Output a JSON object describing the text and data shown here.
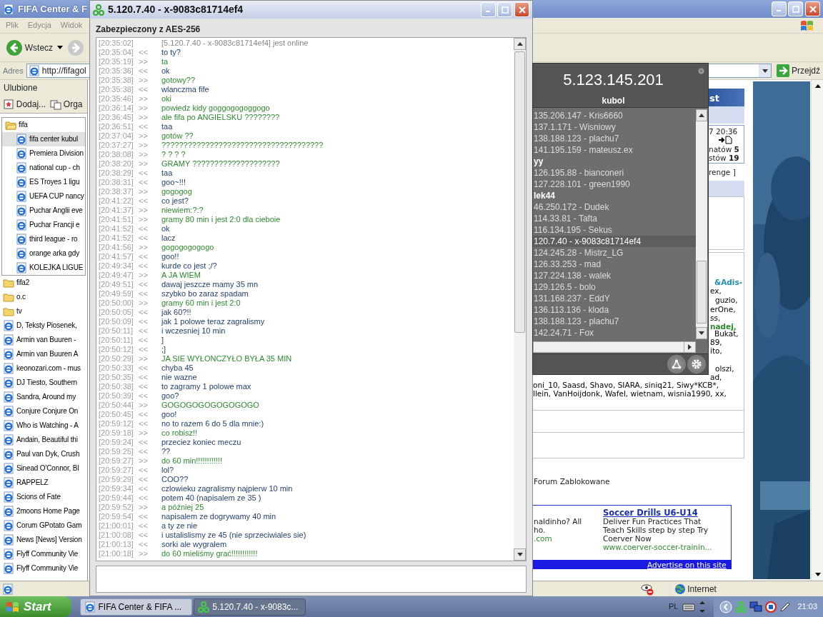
{
  "browser": {
    "title": "FIFA Center & F",
    "menu": [
      "Plik",
      "Edycja",
      "Widok"
    ],
    "back_button": "Wstecz",
    "address_label": "Adres",
    "address": "http://fifagol",
    "go_button": "Przejdź",
    "favorites": {
      "title": "Ulubione",
      "add_button": "Dodaj...",
      "organize_button": "Orga",
      "items": [
        {
          "label": "fifa",
          "kind": "folder",
          "selected": false,
          "expanded": true,
          "children": [
            {
              "label": "fifa center kubul",
              "kind": "page",
              "selected": true
            },
            {
              "label": "Premiera Division",
              "kind": "page",
              "selected": false
            },
            {
              "label": "national cup - ch",
              "kind": "page",
              "selected": false
            },
            {
              "label": "ES Troyes 1 ligu",
              "kind": "page",
              "selected": false
            },
            {
              "label": "UEFA CUP nancy",
              "kind": "page",
              "selected": false
            },
            {
              "label": "Puchar Anglii eve",
              "kind": "page",
              "selected": false
            },
            {
              "label": "Puchar Francji e",
              "kind": "page",
              "selected": false
            },
            {
              "label": "third league - ro",
              "kind": "page",
              "selected": false
            },
            {
              "label": "orange arka gdy",
              "kind": "page",
              "selected": false
            },
            {
              "label": "KOLEJKA LIGUE",
              "kind": "page",
              "selected": false
            }
          ]
        },
        {
          "label": "fifa2",
          "kind": "folder",
          "selected": false,
          "expanded": false
        },
        {
          "label": "o.c",
          "kind": "folder",
          "selected": false,
          "expanded": false
        },
        {
          "label": "tv",
          "kind": "folder",
          "selected": false,
          "expanded": false
        },
        {
          "label": "D, Teksty Piosenek,",
          "kind": "page",
          "selected": false
        },
        {
          "label": "Armin van Buuren -",
          "kind": "page",
          "selected": false
        },
        {
          "label": "Armin van Buuren  A",
          "kind": "page",
          "selected": false
        },
        {
          "label": "keonozari.com - mus",
          "kind": "page",
          "selected": false
        },
        {
          "label": "DJ Tiesto, Southern",
          "kind": "page",
          "selected": false
        },
        {
          "label": "Sandra, Around my",
          "kind": "page",
          "selected": false
        },
        {
          "label": "Conjure Conjure On",
          "kind": "page",
          "selected": false
        },
        {
          "label": "Who is Watching - A",
          "kind": "page",
          "selected": false
        },
        {
          "label": "Andain, Beautiful thi",
          "kind": "page",
          "selected": false
        },
        {
          "label": "Paul van Dyk, Crush",
          "kind": "page",
          "selected": false
        },
        {
          "label": "Sinead O'Connor, Bl",
          "kind": "page",
          "selected": false
        },
        {
          "label": "RAPPELZ",
          "kind": "page",
          "selected": false
        },
        {
          "label": "Scions of Fate",
          "kind": "page",
          "selected": false
        },
        {
          "label": "2moons Home Page",
          "kind": "page",
          "selected": false
        },
        {
          "label": "Corum GPotato Gam",
          "kind": "page",
          "selected": false
        },
        {
          "label": "News [News] Version",
          "kind": "page",
          "selected": false
        },
        {
          "label": "Flyff Community  Vie",
          "kind": "page",
          "selected": false
        },
        {
          "label": "Flyff Community  Vie",
          "kind": "page",
          "selected": false
        }
      ]
    },
    "web_page": {
      "panel_heading": "st",
      "last_post": "7 20:36",
      "topics": "natów **5**",
      "posts": "stów **19**",
      "link_text": "renge ]",
      "online_users": [
        {
          "text": "&Adis-",
          "color": "#1f8fb0",
          "highlighted": true
        },
        {
          "text": "ex,"
        },
        {
          "text": "guzio,"
        },
        {
          "text": "erOne,"
        },
        {
          "text": "ss,"
        },
        {
          "text": "nadej,",
          "color": "#2e8b2e",
          "highlighted": true
        },
        {
          "text": "Bukat,"
        },
        {
          "text": "89,"
        },
        {
          "text": "ito,"
        },
        {
          "text": "olszi,"
        },
        {
          "text": "ad,"
        },
        {
          "text": "oni_10, Saasd, Shavo, SIARA, siniq21, Siwy*KCB*,"
        },
        {
          "text": "llein, VanHoijdonk, Wafel, wietnam, wisnia1990, xx,"
        }
      ],
      "forum_status": "Forum Zablokowane",
      "ad": {
        "left_lines": [
          "naldinho? All",
          "ho."
        ],
        "left_url": ".com",
        "title": "Soccer Drills U6-U14",
        "lines": [
          "Deliver Fun Practices That",
          "Teach Skills step by step Try",
          "Coerver Now"
        ],
        "url": "www.coerver-soccer-trainin...",
        "footer": "Advertise on this site"
      }
    },
    "status_zone": "Internet"
  },
  "chat": {
    "title": "5.120.7.40 - x-9083c81714ef4",
    "security": "Zabezpieczony z AES-256",
    "messages": [
      {
        "time": "[20:35:02]",
        "kind": "system",
        "text": "[5.120.7.40 - x-9083c81714ef4] jest online"
      },
      {
        "time": "[20:35:04]",
        "arrow": "<<",
        "kind": "incoming",
        "text": "to ty?"
      },
      {
        "time": "[20:35:19]",
        "arrow": ">>",
        "kind": "outgoing",
        "text": "ta"
      },
      {
        "time": "[20:35:36]",
        "arrow": "<<",
        "kind": "incoming",
        "text": "ok"
      },
      {
        "time": "[20:35:38]",
        "arrow": ">>",
        "kind": "outgoing",
        "text": "gotowy??"
      },
      {
        "time": "[20:35:38]",
        "arrow": "<<",
        "kind": "incoming",
        "text": "wlanczma fife"
      },
      {
        "time": "[20:35:46]",
        "arrow": ">>",
        "kind": "outgoing",
        "text": "oki"
      },
      {
        "time": "[20:36:14]",
        "arrow": ">>",
        "kind": "outgoing",
        "text": "powiedz kidy goggogogoggogo"
      },
      {
        "time": "[20:36:45]",
        "arrow": ">>",
        "kind": "outgoing",
        "text": "ale fifa po ANGIELSKU   ????????"
      },
      {
        "time": "[20:36:51]",
        "arrow": "<<",
        "kind": "incoming",
        "text": "taa"
      },
      {
        "time": "[20:37:04]",
        "arrow": ">>",
        "kind": "outgoing",
        "text": "gotów ??"
      },
      {
        "time": "[20:37:27]",
        "arrow": ">>",
        "kind": "outgoing",
        "text": "?????????????????????????????????????"
      },
      {
        "time": "[20:38:08]",
        "arrow": ">>",
        "kind": "outgoing",
        "text": "? ? ? ?"
      },
      {
        "time": "[20:38:20]",
        "arrow": ">>",
        "kind": "outgoing",
        "text": "GRAMY     ????????????????????"
      },
      {
        "time": "[20:38:29]",
        "arrow": "<<",
        "kind": "incoming",
        "text": "taa"
      },
      {
        "time": "[20:38:31]",
        "arrow": "<<",
        "kind": "incoming",
        "text": "goo~!!!"
      },
      {
        "time": "[20:38:37]",
        "arrow": ">>",
        "kind": "outgoing",
        "text": "gogogog"
      },
      {
        "time": "[20:41:22]",
        "arrow": "<<",
        "kind": "incoming",
        "text": "co jest?"
      },
      {
        "time": "[20:41:37]",
        "arrow": ">>",
        "kind": "outgoing",
        "text": "niewiem:?:?"
      },
      {
        "time": "[20:41:51]",
        "arrow": ">>",
        "kind": "outgoing",
        "text": "gramy 80 min i jest 2:0 dla cieboie"
      },
      {
        "time": "[20:41:52]",
        "arrow": "<<",
        "kind": "incoming",
        "text": "ok"
      },
      {
        "time": "[20:41:52]",
        "arrow": "<<",
        "kind": "incoming",
        "text": "lacz"
      },
      {
        "time": "[20:41:56]",
        "arrow": ">>",
        "kind": "outgoing",
        "text": "gogogogogogo"
      },
      {
        "time": "[20:41:57]",
        "arrow": "<<",
        "kind": "incoming",
        "text": "goo!!"
      },
      {
        "time": "[20:49:34]",
        "arrow": "<<",
        "kind": "incoming",
        "text": "kurde co jest ;/?"
      },
      {
        "time": "[20:49:47]",
        "arrow": ">>",
        "kind": "outgoing",
        "text": "A JA WIEM"
      },
      {
        "time": "[20:49:51]",
        "arrow": "<<",
        "kind": "incoming",
        "text": "dawaj jeszcze mamy 35 mn"
      },
      {
        "time": "[20:49:59]",
        "arrow": "<<",
        "kind": "incoming",
        "text": "szybko bo zaraz spadam"
      },
      {
        "time": "[20:50:00]",
        "arrow": ">>",
        "kind": "outgoing",
        "text": "gramy 60 min i jest 2:0"
      },
      {
        "time": "[20:50:05]",
        "arrow": "<<",
        "kind": "incoming",
        "text": "jak 60?!!"
      },
      {
        "time": "[20:50:09]",
        "arrow": "<<",
        "kind": "incoming",
        "text": "jak 1 polowe teraz zagralismy"
      },
      {
        "time": "[20:50:11]",
        "arrow": "<<",
        "kind": "incoming",
        "text": "i wczesniej 10 min"
      },
      {
        "time": "[20:50:11]",
        "arrow": "<<",
        "kind": "incoming",
        "text": "]"
      },
      {
        "time": "[20:50:12]",
        "arrow": "<<",
        "kind": "incoming",
        "text": ";]"
      },
      {
        "time": "[20:50:29]",
        "arrow": ">>",
        "kind": "outgoing",
        "text": "JA SIE WYŁONCZYŁO BYŁA 35 MIN"
      },
      {
        "time": "[20:50:33]",
        "arrow": "<<",
        "kind": "incoming",
        "text": "chyba 45"
      },
      {
        "time": "[20:50:35]",
        "arrow": "<<",
        "kind": "incoming",
        "text": "nie wazne"
      },
      {
        "time": "[20:50:38]",
        "arrow": "<<",
        "kind": "incoming",
        "text": "to zagramy 1 polowe max"
      },
      {
        "time": "[20:50:39]",
        "arrow": "<<",
        "kind": "incoming",
        "text": "goo?"
      },
      {
        "time": "[20:50:44]",
        "arrow": ">>",
        "kind": "outgoing",
        "text": "GOGOGOGOGOGOGOGO"
      },
      {
        "time": "[20:50:45]",
        "arrow": "<<",
        "kind": "incoming",
        "text": "goo!"
      },
      {
        "time": "[20:59:12]",
        "arrow": "<<",
        "kind": "incoming",
        "text": "no to razem 6 do 5 dla mnie:)"
      },
      {
        "time": "[20:59:18]",
        "arrow": ">>",
        "kind": "outgoing",
        "text": "co robisz!!"
      },
      {
        "time": "[20:59:24]",
        "arrow": "<<",
        "kind": "incoming",
        "text": "przeciez koniec meczu"
      },
      {
        "time": "[20:59:25]",
        "arrow": "<<",
        "kind": "incoming",
        "text": "??"
      },
      {
        "time": "[20:59:27]",
        "arrow": ">>",
        "kind": "outgoing",
        "text": "do 60 min!!!!!!!!!!!!"
      },
      {
        "time": "[20:59:27]",
        "arrow": "<<",
        "kind": "incoming",
        "text": "lol?"
      },
      {
        "time": "[20:59:29]",
        "arrow": "<<",
        "kind": "incoming",
        "text": "COO??"
      },
      {
        "time": "[20:59:34]",
        "arrow": "<<",
        "kind": "incoming",
        "text": "czlowieku zagralismy najpierw 10 min"
      },
      {
        "time": "[20:59:44]",
        "arrow": "<<",
        "kind": "incoming",
        "text": "potem 40 (napisalem ze 35 )"
      },
      {
        "time": "[20:59:52]",
        "arrow": ">>",
        "kind": "outgoing",
        "text": "a później 25"
      },
      {
        "time": "[20:59:54]",
        "arrow": "<<",
        "kind": "incoming",
        "text": "napisalem ze dogrywamy 40 min"
      },
      {
        "time": "[21:00:01]",
        "arrow": "<<",
        "kind": "incoming",
        "text": "a ty ze nie"
      },
      {
        "time": "[21:00:08]",
        "arrow": "<<",
        "kind": "incoming",
        "text": "i ustalislismy ze 45 (nie sprzeciwiales sie)"
      },
      {
        "time": "[21:00:13]",
        "arrow": "<<",
        "kind": "incoming",
        "text": "sorki ale wygralem"
      },
      {
        "time": "[21:00:18]",
        "arrow": ">>",
        "kind": "outgoing",
        "text": "do 60 mieliśmy grać!!!!!!!!!!!!"
      }
    ]
  },
  "contacts": {
    "address": "5.123.145.201",
    "nickname": "kubol",
    "entries": [
      {
        "kind": "contact",
        "label": "135.206.147 - Kris6660",
        "selected": false
      },
      {
        "kind": "contact",
        "label": "137.1.171 - Wisniowy",
        "selected": false
      },
      {
        "kind": "contact",
        "label": "138.188.123 - plachu7",
        "selected": false
      },
      {
        "kind": "contact",
        "label": "141.195.159 - mateusz.ex",
        "selected": false
      },
      {
        "kind": "group",
        "label": "yy"
      },
      {
        "kind": "contact",
        "label": "126.195.88 - bianconeri",
        "selected": false
      },
      {
        "kind": "contact",
        "label": "127.228.101 - green1990",
        "selected": false
      },
      {
        "kind": "group",
        "label": "lek44"
      },
      {
        "kind": "contact",
        "label": "46.250.172 - Dudek",
        "selected": false
      },
      {
        "kind": "contact",
        "label": "114.33.81 - Tafta",
        "selected": false
      },
      {
        "kind": "contact",
        "label": "116.134.195 - Sekus",
        "selected": false
      },
      {
        "kind": "contact",
        "label": "120.7.40 - x-9083c81714ef4",
        "selected": true
      },
      {
        "kind": "contact",
        "label": "124.245.28 - Mistrz_LG",
        "selected": false
      },
      {
        "kind": "contact",
        "label": "126.33.253 - mad",
        "selected": false
      },
      {
        "kind": "contact",
        "label": "127.224.138 - walek",
        "selected": false
      },
      {
        "kind": "contact",
        "label": "129.126.5 - bolo",
        "selected": false
      },
      {
        "kind": "contact",
        "label": "131.168.237 - EddY",
        "selected": false
      },
      {
        "kind": "contact",
        "label": "136.113.136 - kloda",
        "selected": false
      },
      {
        "kind": "contact",
        "label": "138.188.123 - plachu7",
        "selected": false
      },
      {
        "kind": "contact",
        "label": "142.24.71 - Fox",
        "selected": false
      }
    ]
  },
  "taskbar": {
    "start": "Start",
    "tasks": [
      {
        "label": "FIFA Center & FIFA ...",
        "kind": "browser",
        "selected": false
      },
      {
        "label": "5.120.7.40 - x-9083c...",
        "kind": "chat",
        "selected": true
      }
    ],
    "language": "PL",
    "clock": "21:03"
  }
}
